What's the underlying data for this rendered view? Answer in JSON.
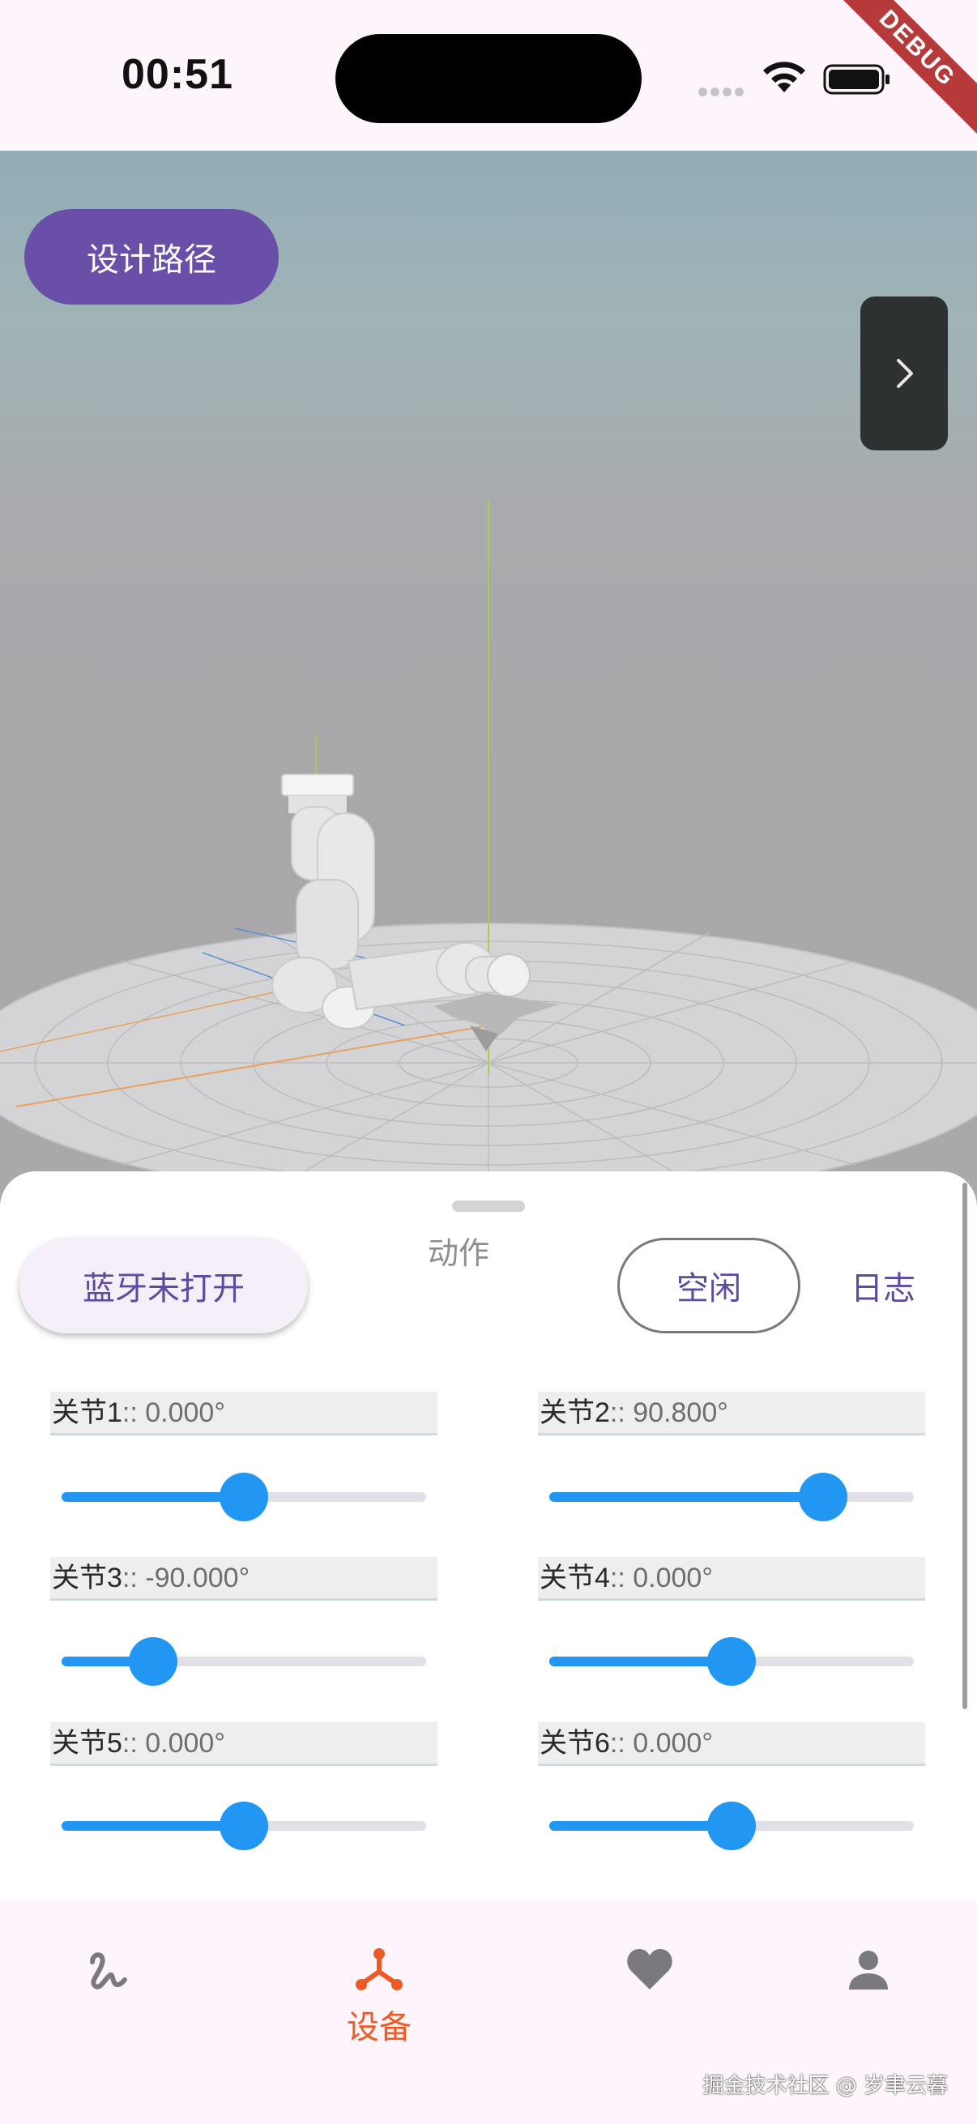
{
  "status_bar": {
    "time": "00:51",
    "debug_ribbon": "DEBUG"
  },
  "viewport": {
    "design_path_button": "设计路径",
    "side_toggle_icon": "chevron-right-icon"
  },
  "control_panel": {
    "bluetooth_button": "蓝牙未打开",
    "action_label": "动作",
    "state_button": "空闲",
    "log_button": "日志",
    "joints": [
      {
        "name": "关节1",
        "value": ":: 0.000°",
        "level": 0.5
      },
      {
        "name": "关节2",
        "value": ":: 90.800°",
        "level": 0.75
      },
      {
        "name": "关节3",
        "value": ":: -90.000°",
        "level": 0.25
      },
      {
        "name": "关节4",
        "value": ":: 0.000°",
        "level": 0.5
      },
      {
        "name": "关节5",
        "value": ":: 0.000°",
        "level": 0.5
      },
      {
        "name": "关节6",
        "value": ":: 0.000°",
        "level": 0.5
      }
    ]
  },
  "bottom_nav": {
    "items": [
      {
        "icon": "squiggle-icon",
        "label": "",
        "active": false
      },
      {
        "icon": "device-icon",
        "label": "设备",
        "active": true
      },
      {
        "icon": "heart-icon",
        "label": "",
        "active": false
      },
      {
        "icon": "person-icon",
        "label": "",
        "active": false
      }
    ],
    "active_color": "#ee5a24",
    "inactive_color": "#7a7a7e"
  },
  "watermark": "掘金技术社区 @ 岁聿云暮",
  "colors": {
    "primary_purple": "#6a4fa8",
    "slider_blue": "#2196f3",
    "accent_orange": "#ee5a24"
  }
}
